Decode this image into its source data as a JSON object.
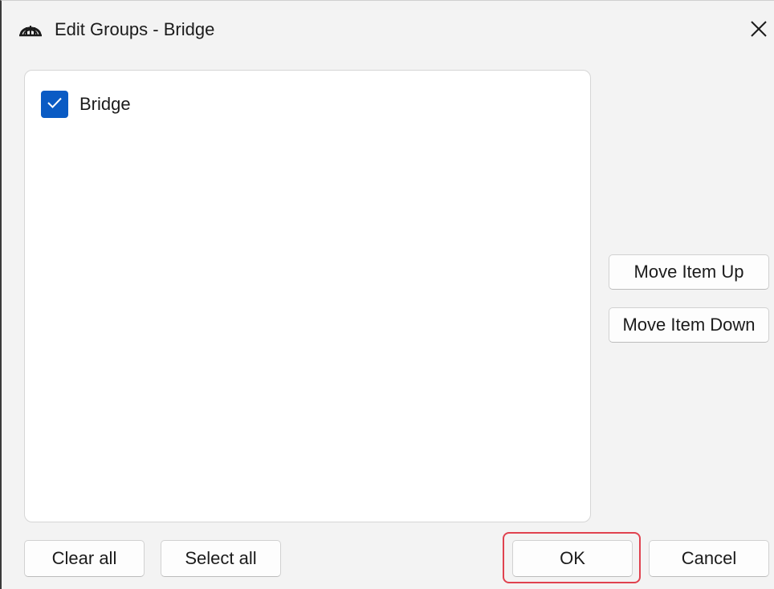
{
  "window": {
    "title": "Edit Groups - Bridge",
    "app_icon": "bridge-arch-icon",
    "close_icon": "close-icon"
  },
  "list": {
    "items": [
      {
        "label": "Bridge",
        "checked": true
      }
    ]
  },
  "side_buttons": {
    "move_up_label": "Move Item Up",
    "move_down_label": "Move Item Down"
  },
  "bottom_buttons": {
    "clear_all_label": "Clear all",
    "select_all_label": "Select all",
    "ok_label": "OK",
    "cancel_label": "Cancel"
  },
  "colors": {
    "checkbox_accent": "#0a5bc4",
    "highlight": "#e0424f",
    "window_bg": "#f3f3f3"
  }
}
